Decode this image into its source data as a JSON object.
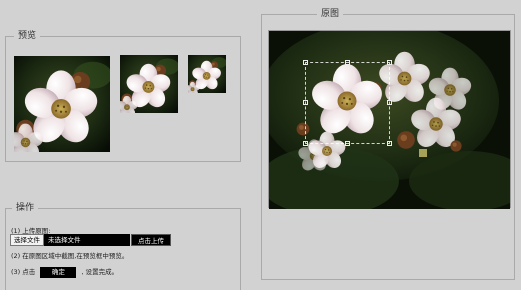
{
  "preview": {
    "title": "预览"
  },
  "original": {
    "title": "原图"
  },
  "operations": {
    "title": "操作",
    "step1_label": "(1) 上传原图:",
    "choose_file_label": "选择文件",
    "file_status": "未选择文件",
    "upload_label": "点击上传",
    "step2_label": "(2) 在原图区域中截图,在预览框中预览。",
    "step3_prefix": "(3) 点击",
    "confirm_label": "确定",
    "step3_suffix": ", 设置完成。"
  },
  "colors": {
    "page_bg": "#d2d2d2",
    "button_dark": "#000000",
    "frame_border": "#a9a9a9"
  }
}
